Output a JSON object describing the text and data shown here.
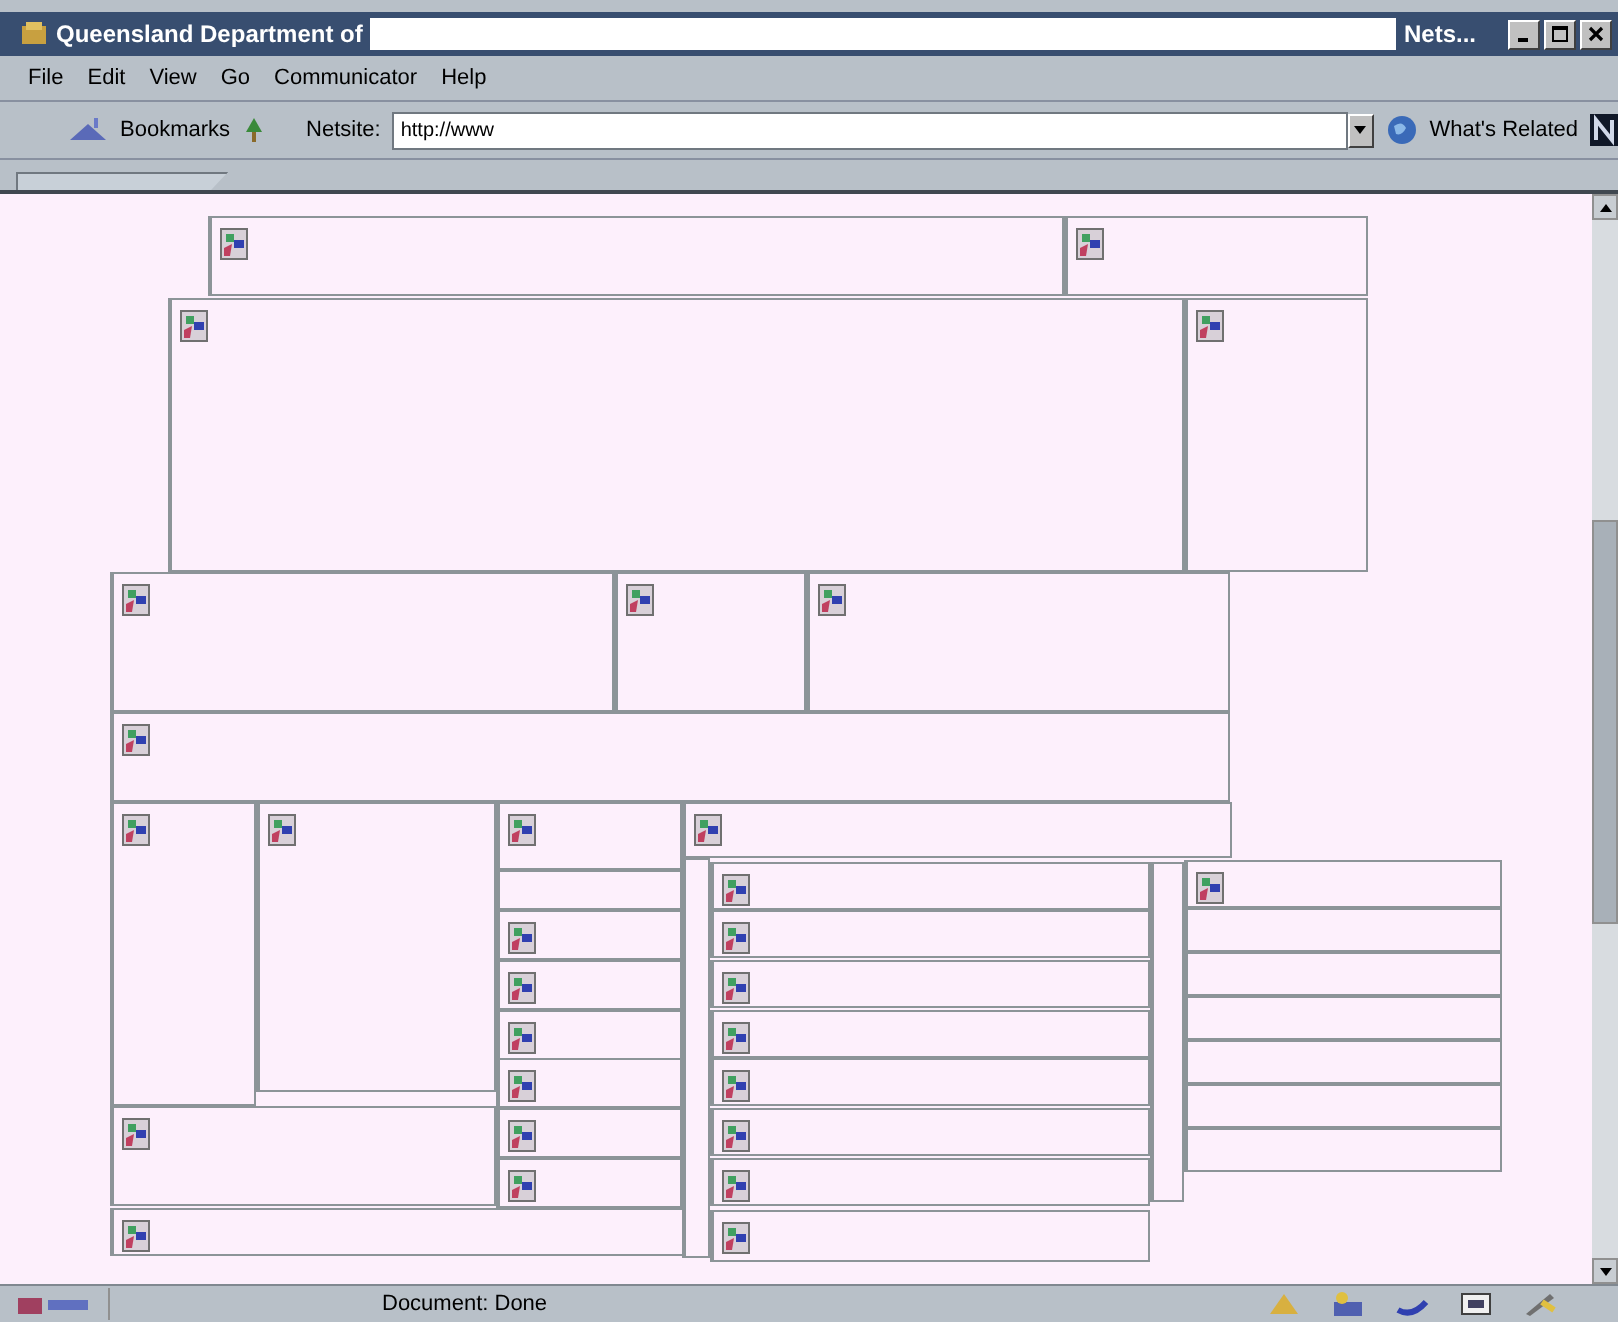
{
  "window": {
    "title": "Queensland Department of",
    "title_tail": "Nets..."
  },
  "menu": [
    "File",
    "Edit",
    "View",
    "Go",
    "Communicator",
    "Help"
  ],
  "toolbar": {
    "bookmarks": "Bookmarks",
    "location_label": "Netsite:",
    "url": "http://www",
    "related": "What's Related"
  },
  "status_bar": {
    "text": "Document: Done"
  }
}
